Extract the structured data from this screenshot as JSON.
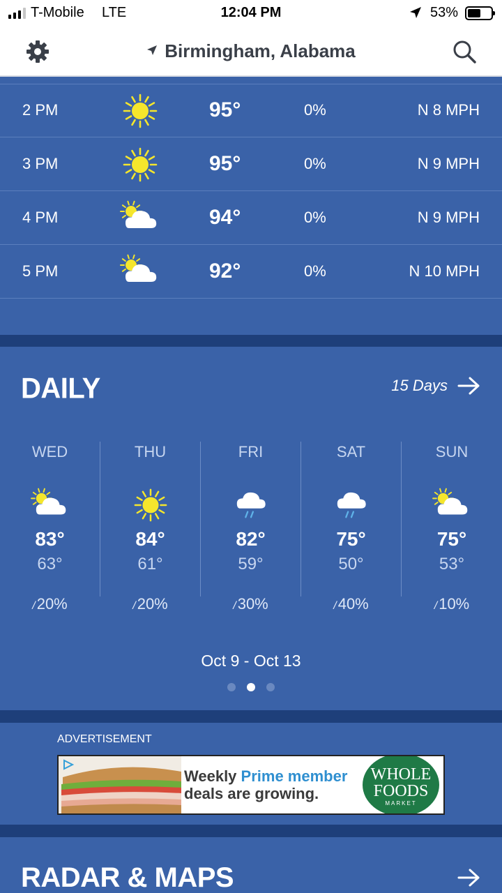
{
  "status_bar": {
    "carrier": "T-Mobile",
    "network": "LTE",
    "time": "12:04 PM",
    "battery": "53%"
  },
  "header": {
    "location": "Birmingham, Alabama"
  },
  "hourly": [
    {
      "time": "2 PM",
      "icon": "sunny-icon",
      "temp": "95°",
      "precip": "0%",
      "wind": "N 8 MPH"
    },
    {
      "time": "3 PM",
      "icon": "sunny-icon",
      "temp": "95°",
      "precip": "0%",
      "wind": "N 9 MPH"
    },
    {
      "time": "4 PM",
      "icon": "partly-cloudy-icon",
      "temp": "94°",
      "precip": "0%",
      "wind": "N 9 MPH"
    },
    {
      "time": "5 PM",
      "icon": "partly-cloudy-icon",
      "temp": "92°",
      "precip": "0%",
      "wind": "N 10 MPH"
    }
  ],
  "daily": {
    "title": "DAILY",
    "more_label": "15 Days",
    "days": [
      {
        "day": "WED",
        "icon": "partly-cloudy-icon",
        "high": "83°",
        "low": "63°",
        "precip": "20%"
      },
      {
        "day": "THU",
        "icon": "sunny-icon",
        "high": "84°",
        "low": "61°",
        "precip": "20%"
      },
      {
        "day": "FRI",
        "icon": "rain-icon",
        "high": "82°",
        "low": "59°",
        "precip": "30%"
      },
      {
        "day": "SAT",
        "icon": "rain-icon",
        "high": "75°",
        "low": "50°",
        "precip": "40%"
      },
      {
        "day": "SUN",
        "icon": "partly-cloudy-icon",
        "high": "75°",
        "low": "53°",
        "precip": "10%"
      }
    ],
    "range": "Oct 9 - Oct 13",
    "page_count": 3,
    "active_page": 2
  },
  "ad": {
    "label": "ADVERTISEMENT",
    "line1_a": "Weekly",
    "line1_b": "Prime member",
    "line2": "deals are growing.",
    "brand_1": "WHOLE",
    "brand_2": "FOODS",
    "brand_3": "MARKET"
  },
  "radar": {
    "title": "RADAR & MAPS"
  },
  "colors": {
    "panel": "#3a62a8",
    "band": "#1e3f7a",
    "sun": "#f5e62c"
  }
}
